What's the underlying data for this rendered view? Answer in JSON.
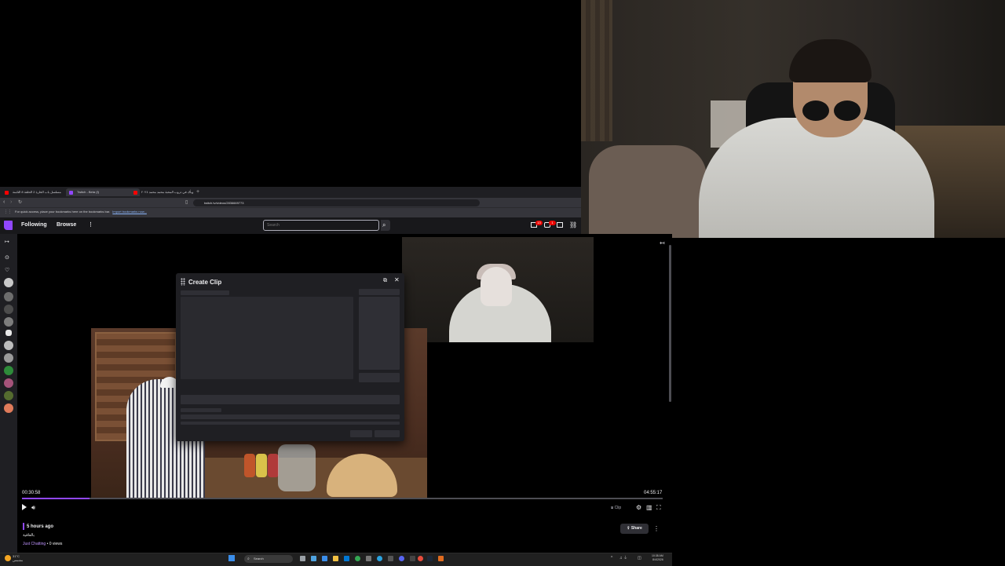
{
  "browser": {
    "tabs": [
      {
        "label": "مسلسل باب الحارة 2 الحلقة 8 الثامنة",
        "icon_color": "#ff0000"
      },
      {
        "label": "Twitch - Beta (f)",
        "icon_color": "#9147ff"
      },
      {
        "label": "وبأك في دروب المحبة محمد محمد ٢٠٢٤",
        "icon_color": "#ff0000"
      }
    ],
    "new_tab": "+",
    "url": "twitch.tv/videos/2836669773",
    "bookmarks_hint": "For quick access, place your bookmarks here on the bookmarks bar.",
    "bookmarks_link": "Import bookmarks now..."
  },
  "twitch": {
    "nav": {
      "following": "Following",
      "browse": "Browse",
      "more": "⋮"
    },
    "search": {
      "placeholder": "Search"
    },
    "notifications": {
      "inbox_count": "13",
      "alerts_count": "1"
    },
    "accent": "#9147ff"
  },
  "player": {
    "current_time": "00:30:58",
    "duration": "04:55:17",
    "progress_fraction": 0.105,
    "clip_label": "Clip"
  },
  "modal": {
    "title": "Create Clip"
  },
  "video_info": {
    "posted": "5 hours ago",
    "title": "بالعافية",
    "category": "Just Chatting",
    "views": " • 0 views",
    "share_label": "Share"
  },
  "taskbar": {
    "weather_temp": "31°C",
    "weather_desc": "مشمس",
    "search": "Search",
    "time": "10:38 AM",
    "date": "8/4/2026"
  }
}
